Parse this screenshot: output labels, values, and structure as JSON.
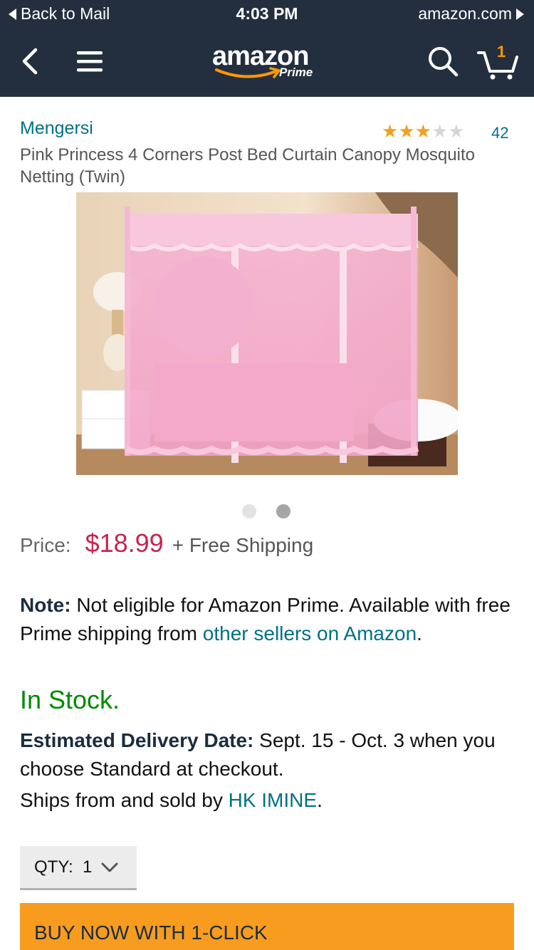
{
  "status_bar": {
    "back_label": "Back to Mail",
    "time": "4:03 PM",
    "site": "amazon.com"
  },
  "nav": {
    "logo_word": "amazon",
    "logo_sub": "Prime",
    "cart_count": "1",
    "icons": [
      "chevron-left-icon",
      "menu-icon",
      "search-icon",
      "cart-icon"
    ]
  },
  "product": {
    "brand": "Mengersi",
    "rating_stars": 3,
    "rating_max": 5,
    "rating_count": "42",
    "title": "Pink Princess 4 Corners Post Bed Curtain Canopy Mosquito Netting (Twin)",
    "image_count": 2,
    "active_image": 2
  },
  "price": {
    "label": "Price:",
    "value": "$18.99",
    "shipping": "+ Free Shipping"
  },
  "note": {
    "label": "Note:",
    "text": " Not eligible for Amazon Prime. Available with free Prime shipping from ",
    "link": "other sellers on Amazon",
    "end": "."
  },
  "stock": "In Stock.",
  "delivery": {
    "label": "Estimated Delivery Date:",
    "text": " Sept. 15 - Oct. 3 when you choose Standard at checkout."
  },
  "ships": {
    "text": "Ships from and sold by ",
    "seller": "HK IMINE",
    "end": "."
  },
  "qty": {
    "label": "QTY:",
    "value": "1"
  },
  "buy_button": "BUY NOW WITH 1-CLICK",
  "colors": {
    "nav_bg": "#232f3e",
    "link": "#007185",
    "price": "#c7254e",
    "stock": "#008a00",
    "buy_button": "#f79c1f",
    "star": "#f0a020"
  }
}
